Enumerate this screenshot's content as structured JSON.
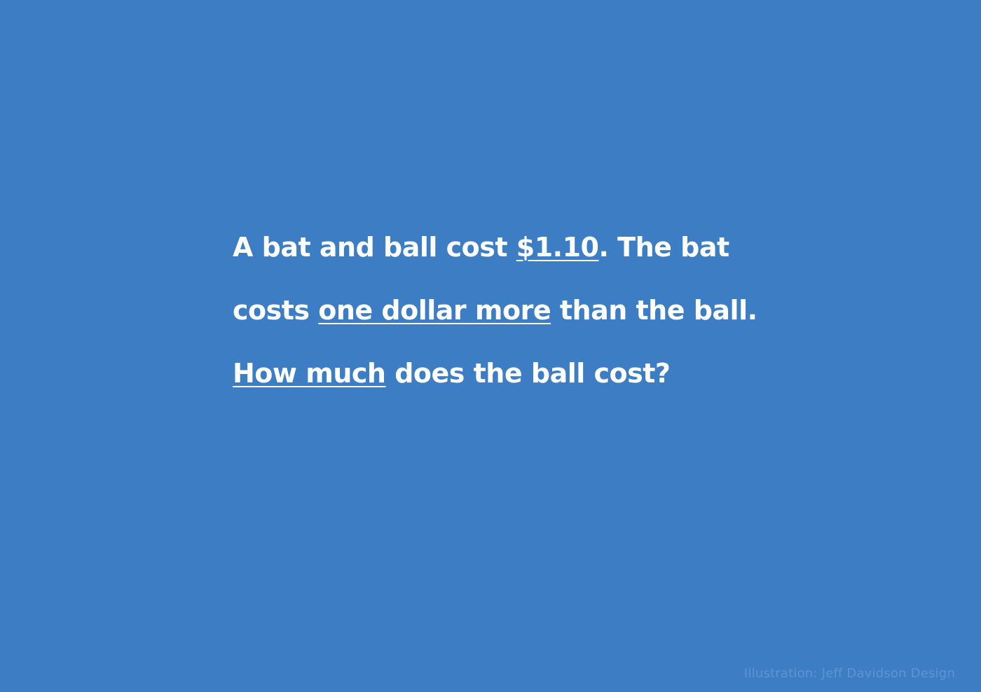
{
  "puzzle": {
    "line1": {
      "before": "A bat and ball cost ",
      "underlined": "$1.10",
      "after": ". The bat"
    },
    "line2": {
      "before": "costs ",
      "underlined": "one dollar more",
      "after": " than the ball."
    },
    "line3": {
      "underlined": "How much",
      "after": " does the ball cost?"
    }
  },
  "credit": "Illustration: Jeff Davidson Design",
  "colors": {
    "background": "#3c7dc4",
    "text": "#ffffff",
    "credit": "#5d95d0"
  }
}
